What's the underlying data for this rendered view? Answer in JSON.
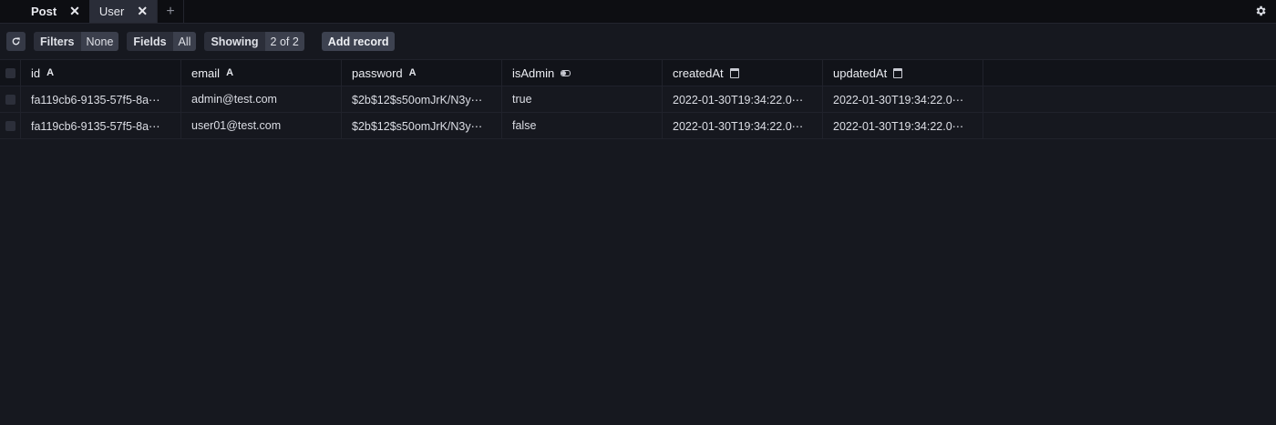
{
  "tabs": [
    {
      "label": "Post",
      "active": true
    },
    {
      "label": "User",
      "active": false
    }
  ],
  "tab_add_label": "+",
  "tab_close_glyph": "✕",
  "toolbar": {
    "filters_key": "Filters",
    "filters_value": "None",
    "fields_key": "Fields",
    "fields_value": "All",
    "showing_key": "Showing",
    "showing_value": "2 of 2",
    "add_record_label": "Add record"
  },
  "columns": [
    {
      "name": "id",
      "type_icon": "A"
    },
    {
      "name": "email",
      "type_icon": "A"
    },
    {
      "name": "password",
      "type_icon": "A"
    },
    {
      "name": "isAdmin",
      "type_icon": "toggle-icon"
    },
    {
      "name": "createdAt",
      "type_icon": "calendar-icon"
    },
    {
      "name": "updatedAt",
      "type_icon": "calendar-icon"
    }
  ],
  "rows": [
    [
      "fa119cb6-9135-57f5-8a⋯",
      "admin@test.com",
      "$2b$12$s50omJrK/N3y⋯",
      "true",
      "2022-01-30T19:34:22.0⋯",
      "2022-01-30T19:34:22.0⋯"
    ],
    [
      "fa119cb6-9135-57f5-8a⋯",
      "user01@test.com",
      "$2b$12$s50omJrK/N3y⋯",
      "false",
      "2022-01-30T19:34:22.0⋯",
      "2022-01-30T19:34:22.0⋯"
    ]
  ],
  "colors": {
    "background": "#16181f",
    "tabbar": "#0d0e12",
    "pill_key": "#2b2e39",
    "pill_value": "#3b3f4c"
  }
}
